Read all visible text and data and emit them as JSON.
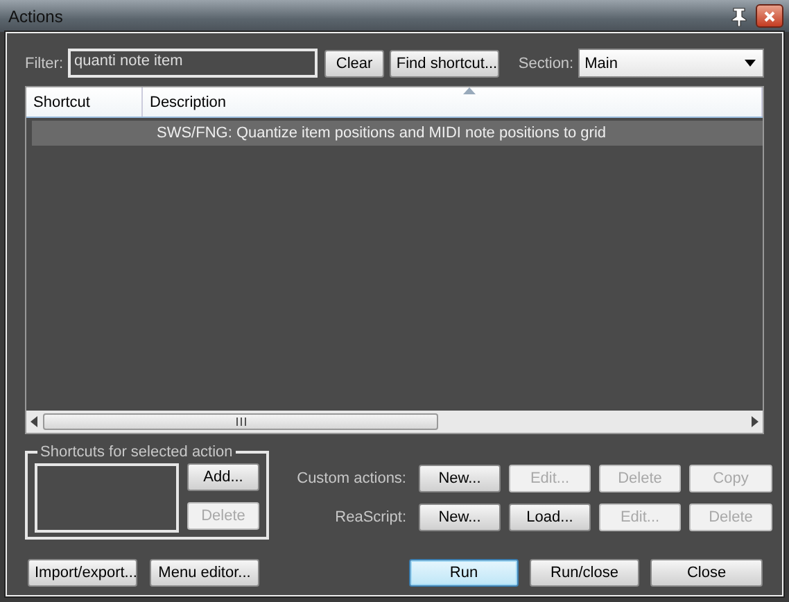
{
  "window": {
    "title": "Actions"
  },
  "filter": {
    "label": "Filter:",
    "value": "quanti note item"
  },
  "filter_buttons": [
    {
      "label": "Clear",
      "disabled": false
    },
    {
      "label": "Find shortcut...",
      "disabled": false
    }
  ],
  "section": {
    "label": "Section:",
    "value": "Main"
  },
  "table": {
    "columns": [
      {
        "label": "Shortcut",
        "sorted": false
      },
      {
        "label": "Description",
        "sorted": true
      }
    ],
    "rows": [
      {
        "description": "SWS/FNG: Quantize item positions and MIDI note positions to grid",
        "selected": true
      }
    ]
  },
  "shortcuts_group": {
    "title": "Shortcuts for selected action",
    "buttons": [
      {
        "label": "Add...",
        "disabled": false
      },
      {
        "label": "Delete",
        "disabled": true
      }
    ]
  },
  "custom_actions": {
    "label": "Custom actions:",
    "buttons": [
      {
        "label": "New...",
        "disabled": false
      },
      {
        "label": "Edit...",
        "disabled": true
      },
      {
        "label": "Delete",
        "disabled": true
      },
      {
        "label": "Copy",
        "disabled": true
      }
    ]
  },
  "reascript": {
    "label": "ReaScript:",
    "buttons": [
      {
        "label": "New...",
        "disabled": false
      },
      {
        "label": "Load...",
        "disabled": false
      },
      {
        "label": "Edit...",
        "disabled": true
      },
      {
        "label": "Delete",
        "disabled": true
      }
    ]
  },
  "bottom_left_buttons": [
    {
      "label": "Import/export...",
      "disabled": false,
      "default": false
    },
    {
      "label": "Menu editor...",
      "disabled": false,
      "default": false
    }
  ],
  "bottom_right_buttons": [
    {
      "label": "Run",
      "disabled": false,
      "default": true
    },
    {
      "label": "Run/close",
      "disabled": false,
      "default": false
    },
    {
      "label": "Close",
      "disabled": false,
      "default": false
    }
  ]
}
